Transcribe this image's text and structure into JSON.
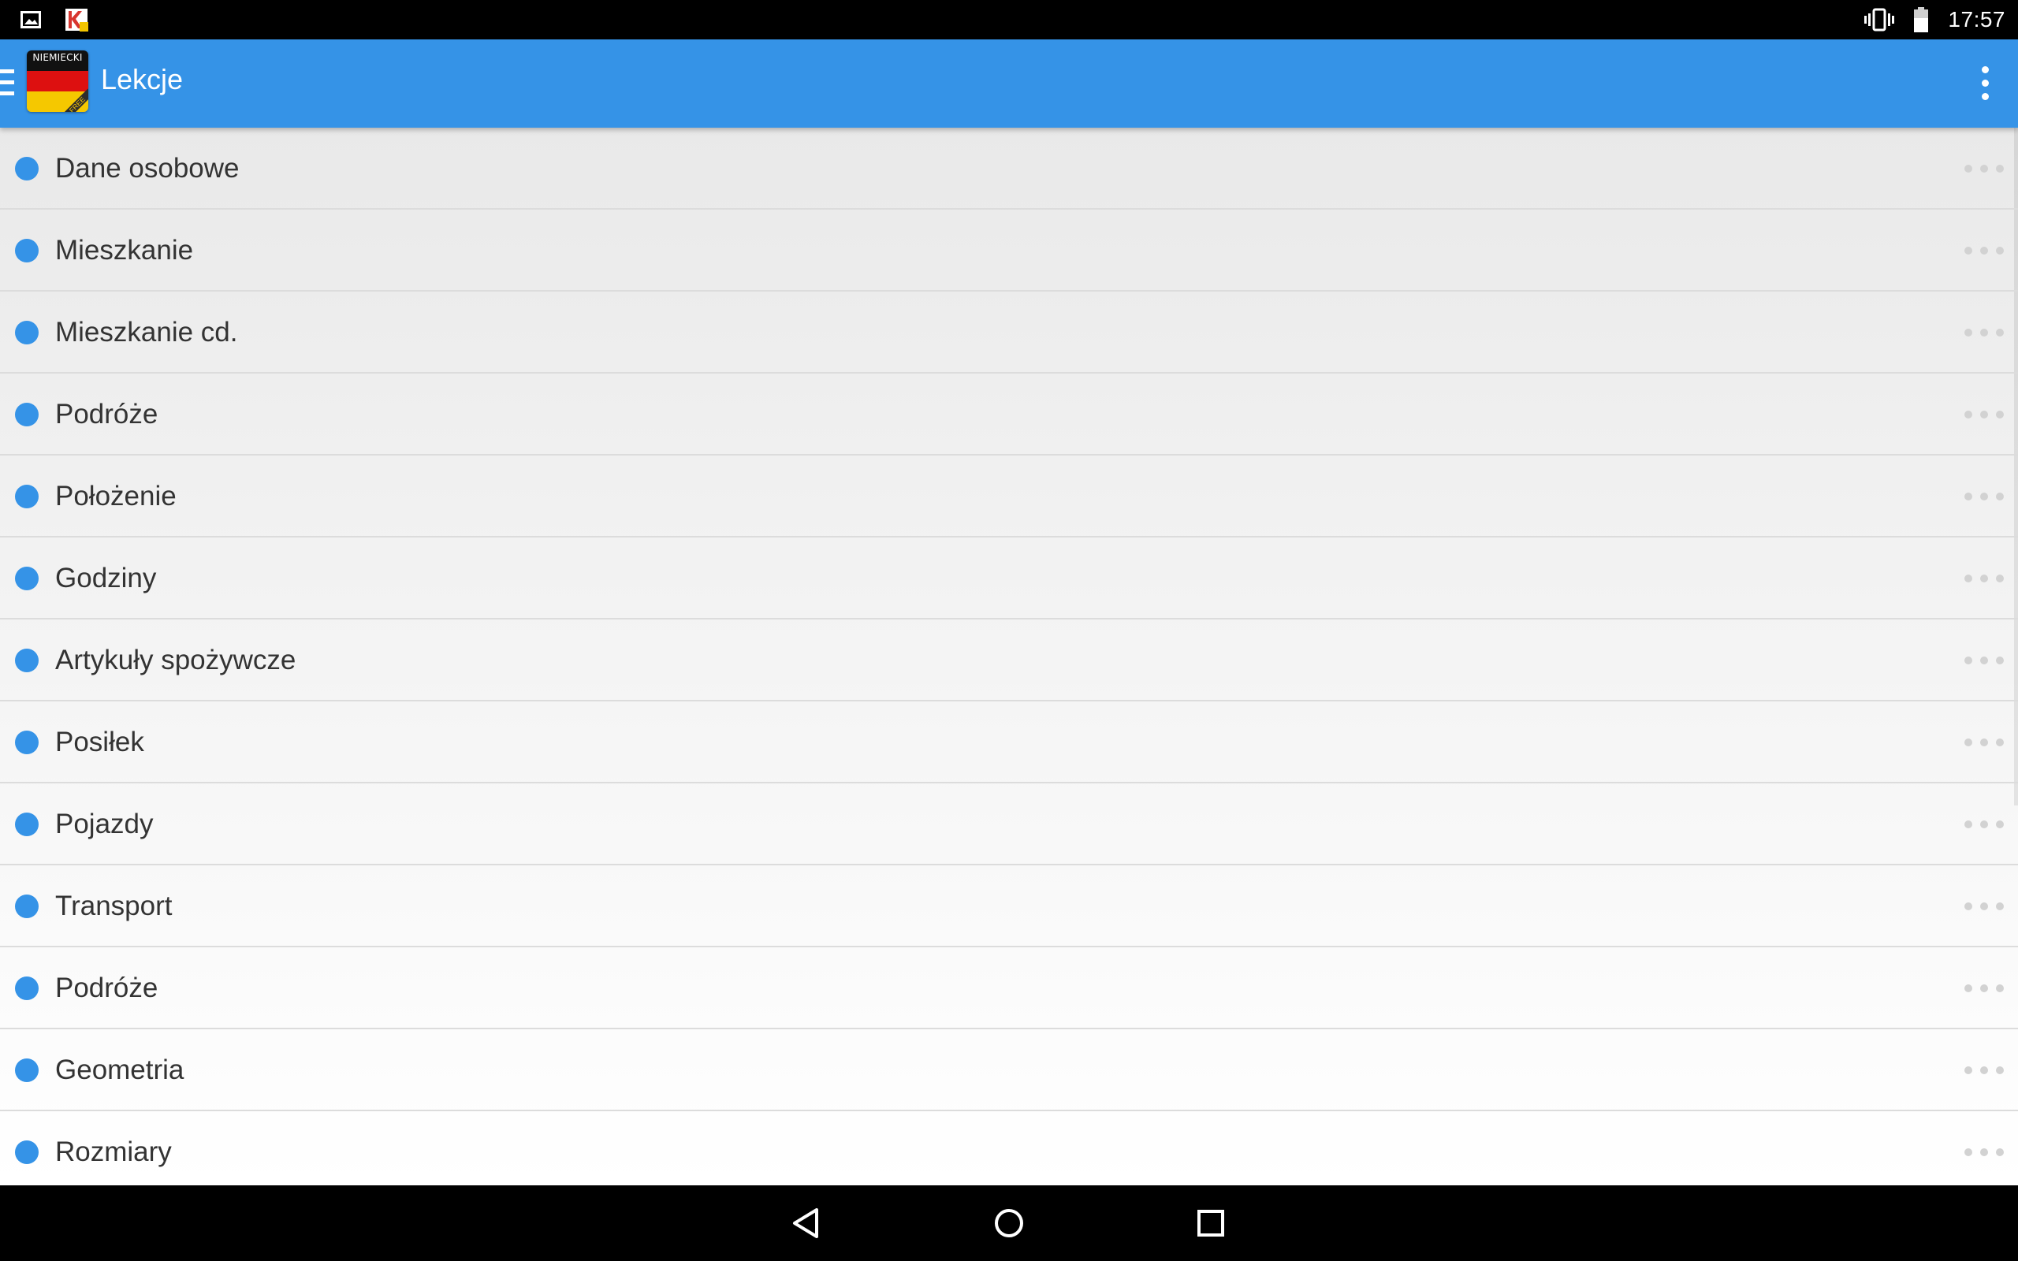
{
  "status_bar": {
    "time": "17:57",
    "notification_icons": [
      "image-icon",
      "kaspersky-icon"
    ],
    "system_icons": [
      "vibrate-icon",
      "battery-icon"
    ]
  },
  "app_bar": {
    "title": "Lekcje",
    "logo_brand": "NIEMIECKI",
    "logo_badge": "FREE",
    "menu_icon": "hamburger-icon",
    "overflow_icon": "more-vert-icon"
  },
  "colors": {
    "accent": "#3593e7",
    "status_bar": "#000000",
    "nav_bar": "#000000",
    "list_text": "#333333",
    "divider": "#dcdcdc"
  },
  "lessons": {
    "items": [
      {
        "label": "Dane osobowe"
      },
      {
        "label": "Mieszkanie"
      },
      {
        "label": "Mieszkanie cd."
      },
      {
        "label": "Podróże"
      },
      {
        "label": "Położenie"
      },
      {
        "label": "Godziny"
      },
      {
        "label": "Artykuły spożywcze"
      },
      {
        "label": "Posiłek"
      },
      {
        "label": "Pojazdy"
      },
      {
        "label": "Transport"
      },
      {
        "label": "Podróże"
      },
      {
        "label": "Geometria"
      },
      {
        "label": "Rozmiary"
      }
    ]
  },
  "nav_bar": {
    "icons": [
      "back-icon",
      "home-icon",
      "recents-icon"
    ]
  }
}
